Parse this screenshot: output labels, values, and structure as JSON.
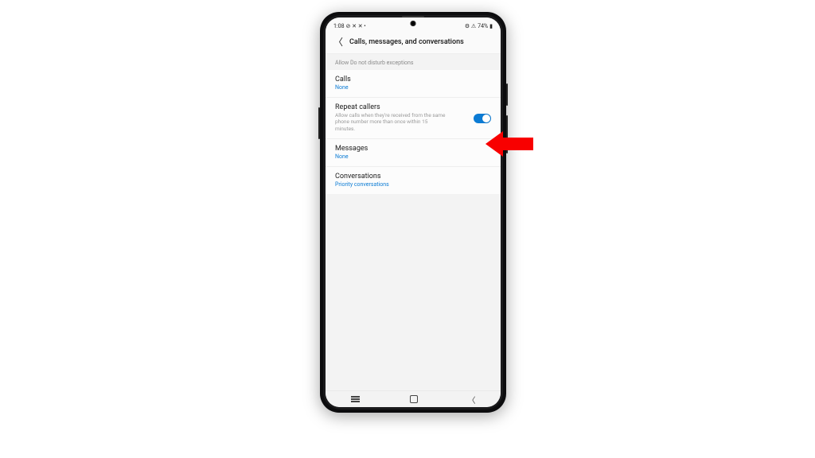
{
  "status": {
    "time": "1:08",
    "left_icons": "⊘ ✕ ✕ •",
    "right_icons": "⚙ ⚠",
    "battery": "74%"
  },
  "header": {
    "title": "Calls, messages, and conversations"
  },
  "section_label": "Allow Do not disturb exceptions",
  "rows": {
    "calls": {
      "title": "Calls",
      "value": "None"
    },
    "repeat": {
      "title": "Repeat callers",
      "desc": "Allow calls when they're received from the same phone number more than once within 15 minutes.",
      "toggle_on": true
    },
    "messages": {
      "title": "Messages",
      "value": "None"
    },
    "conversations": {
      "title": "Conversations",
      "value": "Priority conversations"
    }
  },
  "colors": {
    "accent": "#0b7bd4",
    "arrow": "#f80000"
  }
}
